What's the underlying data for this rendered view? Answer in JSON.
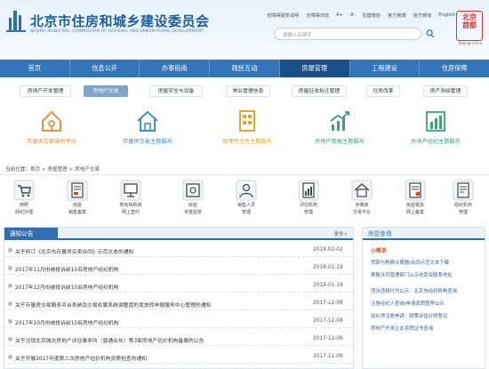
{
  "header": {
    "title": "北京市住房和城乡建设委员会",
    "subtitle": "BEIJING MUNICIPAL COMMISSION OF HOUSING AND URBAN-RURAL DEVELOPMENT",
    "top_links": [
      "无障碍服务说明",
      "无障碍浏览",
      "A+",
      "A-",
      "住建微信",
      "官方微博",
      "官方微信",
      "English"
    ],
    "search_placeholder": "请输入关键字",
    "seal_text": "北京市\n首都",
    "seal_sub": "Beijing China"
  },
  "nav": {
    "items": [
      "首页",
      "信息公开",
      "办事指南",
      "政民互动",
      "房屋管理",
      "工程建设",
      "住房保障"
    ],
    "active_index": 4
  },
  "subnav": {
    "items": [
      "房地产开发管理",
      "房地产交易",
      "房屋安全与设备",
      "物业管理信息",
      "房屋征收拆迁管理",
      "住房改革",
      "房产测绘管理"
    ],
    "active_index": 1
  },
  "platforms": [
    {
      "label": "存量房交易服务平台",
      "color": "#e9913c",
      "icon": "house-key-icon"
    },
    {
      "label": "存量房交易主题服务",
      "color": "#3f8ed0",
      "icon": "house-outline-icon"
    },
    {
      "label": "保障性住房主题服务",
      "color": "#e3a72b",
      "icon": "building-grid-icon"
    },
    {
      "label": "房地产数据主题服务",
      "color": "#3aa37c",
      "icon": "growth-chart-icon"
    },
    {
      "label": "房地产经纪主题服务",
      "color": "#3aa37c",
      "icon": "bar-chart-icon"
    }
  ],
  "breadcrumb": "当前位置：首页 > 房屋管理 > 房地产交易",
  "services": [
    {
      "lines": [
        "持照",
        "经纪办理"
      ],
      "icon": "cart-icon"
    },
    {
      "lines": [
        "房屋",
        "销售备案"
      ],
      "icon": "sale-doc-icon"
    },
    {
      "lines": [
        "既有和新房",
        "网上签约"
      ],
      "icon": "monitor-icon"
    },
    {
      "lines": [
        "房屋",
        "资金监管"
      ],
      "icon": "safe-icon"
    },
    {
      "lines": [
        "销售人员",
        "管理"
      ],
      "icon": "person-icon"
    },
    {
      "lines": [
        "评估机构",
        "管理"
      ],
      "icon": "chart-doc-icon"
    },
    {
      "lines": [
        "存量房",
        "交易平台"
      ],
      "icon": "house-platform-icon"
    },
    {
      "lines": [
        "房屋租赁",
        "网上备案"
      ],
      "icon": "rental-doc-icon"
    },
    {
      "lines": [
        "经纪机构",
        "管理"
      ],
      "icon": "agency-doc-icon"
    }
  ],
  "notices": {
    "tab_label": "通知公告",
    "more_label": "更多>",
    "items": [
      {
        "title": "关于修订《北京市存量房买卖合同》示范文本的通知",
        "date": "2018-02-02"
      },
      {
        "title": "2017年11月份被投诉前10名房地产经纪机构",
        "date": "2018-01-19"
      },
      {
        "title": "2017年12月份被投诉前10名房地产经纪机构",
        "date": "2018-01-19"
      },
      {
        "title": "关于存量房交易服务平台系统及交易权属系统调整盘的发放转申报服务中心管理的通知",
        "date": "2017-12-08"
      },
      {
        "title": "2017年10月份被投诉前10名房地产经纪机构",
        "date": "2017-12-08"
      },
      {
        "title": "关于注销北京城志房地产评估事务所（普通合伙）等3家房地产估价机构备案的公告",
        "date": "2017-12-06"
      },
      {
        "title": "关于开展2017年度第二次房地产估价机构资质检查的通知",
        "date": "2017-11-09"
      }
    ]
  },
  "query": {
    "title": "房屋查询",
    "section_label": "小帮手",
    "links": [
      "贷款与税费计算器|合同示范文本下载",
      "预售许可管理部门公示信息及联系地址",
      "违法违规行为公示：北京市经纪机构查询",
      "注册经纪人查询|申请资质暂停公示",
      "估价师注册申请：政策业估价师登记",
      "房地产开发企业资质证书查询"
    ]
  },
  "colors": {
    "nav_bg": "#3474b8",
    "nav_active": "#1b4f8a",
    "accent": "#2f6fb0"
  }
}
